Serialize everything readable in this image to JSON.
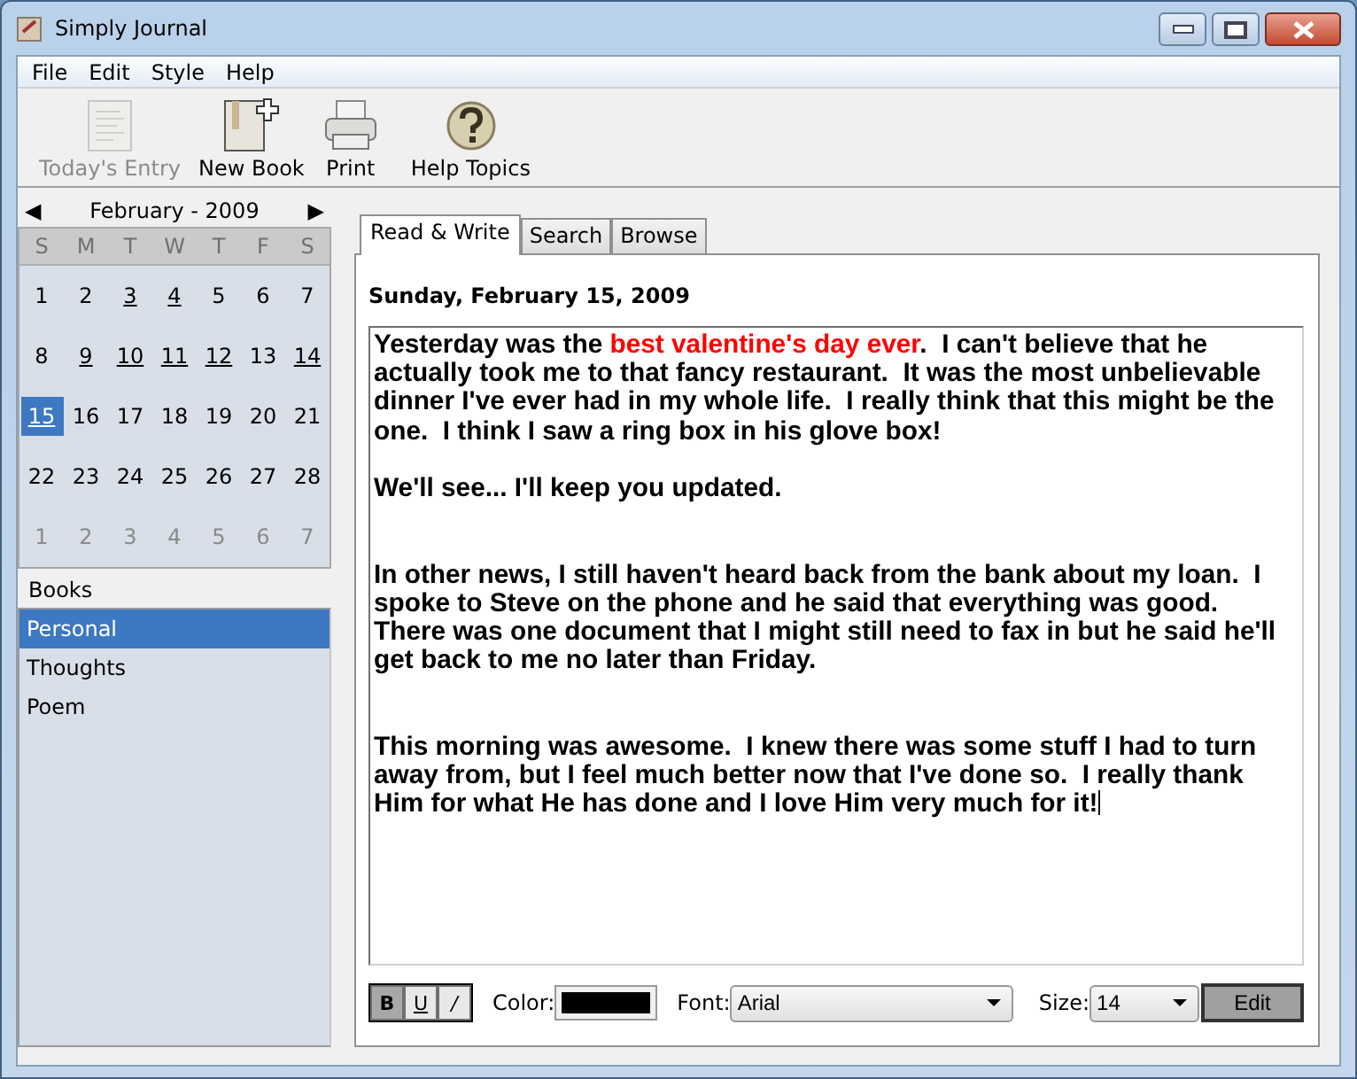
{
  "window": {
    "title": "Simply Journal"
  },
  "menu": [
    {
      "label": "File"
    },
    {
      "label": "Edit"
    },
    {
      "label": "Style"
    },
    {
      "label": "Help"
    }
  ],
  "toolbar": [
    {
      "label": "Today's Entry",
      "kind": "page",
      "disabled": true
    },
    {
      "label": "New Book",
      "kind": "book",
      "disabled": false
    },
    {
      "label": "Print",
      "kind": "printer",
      "disabled": false
    },
    {
      "label": "Help Topics",
      "kind": "help",
      "disabled": false
    }
  ],
  "calendar": {
    "prev": "◀",
    "month": "February - 2009",
    "next": "▶",
    "weekdays": [
      "S",
      "M",
      "T",
      "W",
      "T",
      "F",
      "S"
    ],
    "days": [
      {
        "label": "1",
        "kind": "current",
        "has_entry": false,
        "selected": false
      },
      {
        "label": "2",
        "kind": "current",
        "has_entry": false,
        "selected": false
      },
      {
        "label": "3",
        "kind": "current",
        "has_entry": true,
        "selected": false
      },
      {
        "label": "4",
        "kind": "current",
        "has_entry": true,
        "selected": false
      },
      {
        "label": "5",
        "kind": "current",
        "has_entry": false,
        "selected": false
      },
      {
        "label": "6",
        "kind": "current",
        "has_entry": false,
        "selected": false
      },
      {
        "label": "7",
        "kind": "current",
        "has_entry": false,
        "selected": false
      },
      {
        "label": "8",
        "kind": "current",
        "has_entry": false,
        "selected": false
      },
      {
        "label": "9",
        "kind": "current",
        "has_entry": true,
        "selected": false
      },
      {
        "label": "10",
        "kind": "current",
        "has_entry": true,
        "selected": false
      },
      {
        "label": "11",
        "kind": "current",
        "has_entry": true,
        "selected": false
      },
      {
        "label": "12",
        "kind": "current",
        "has_entry": true,
        "selected": false
      },
      {
        "label": "13",
        "kind": "current",
        "has_entry": false,
        "selected": false
      },
      {
        "label": "14",
        "kind": "current",
        "has_entry": true,
        "selected": false
      },
      {
        "label": "15",
        "kind": "current",
        "has_entry": true,
        "selected": true
      },
      {
        "label": "16",
        "kind": "current",
        "has_entry": false,
        "selected": false
      },
      {
        "label": "17",
        "kind": "current",
        "has_entry": false,
        "selected": false
      },
      {
        "label": "18",
        "kind": "current",
        "has_entry": false,
        "selected": false
      },
      {
        "label": "19",
        "kind": "current",
        "has_entry": false,
        "selected": false
      },
      {
        "label": "20",
        "kind": "current",
        "has_entry": false,
        "selected": false
      },
      {
        "label": "21",
        "kind": "current",
        "has_entry": false,
        "selected": false
      },
      {
        "label": "22",
        "kind": "current",
        "has_entry": false,
        "selected": false
      },
      {
        "label": "23",
        "kind": "current",
        "has_entry": false,
        "selected": false
      },
      {
        "label": "24",
        "kind": "current",
        "has_entry": false,
        "selected": false
      },
      {
        "label": "25",
        "kind": "current",
        "has_entry": false,
        "selected": false
      },
      {
        "label": "26",
        "kind": "current",
        "has_entry": false,
        "selected": false
      },
      {
        "label": "27",
        "kind": "current",
        "has_entry": false,
        "selected": false
      },
      {
        "label": "28",
        "kind": "current",
        "has_entry": false,
        "selected": false
      },
      {
        "label": "1",
        "kind": "other",
        "has_entry": false,
        "selected": false
      },
      {
        "label": "2",
        "kind": "other",
        "has_entry": false,
        "selected": false
      },
      {
        "label": "3",
        "kind": "other",
        "has_entry": false,
        "selected": false
      },
      {
        "label": "4",
        "kind": "other",
        "has_entry": false,
        "selected": false
      },
      {
        "label": "5",
        "kind": "other",
        "has_entry": false,
        "selected": false
      },
      {
        "label": "6",
        "kind": "other",
        "has_entry": false,
        "selected": false
      },
      {
        "label": "7",
        "kind": "other",
        "has_entry": false,
        "selected": false
      }
    ]
  },
  "books": {
    "title": "Books",
    "items": [
      {
        "label": "Personal",
        "selected": true
      },
      {
        "label": "Thoughts",
        "selected": false
      },
      {
        "label": "Poem",
        "selected": false
      }
    ]
  },
  "tabs": [
    {
      "label": "Read & Write",
      "selected": true
    },
    {
      "label": "Search",
      "selected": false
    },
    {
      "label": "Browse",
      "selected": false
    }
  ],
  "entry": {
    "date": "Sunday, February 15, 2009",
    "runs": [
      {
        "text": "Yesterday was the ",
        "color": "#000000"
      },
      {
        "text": "best valentine's day ever",
        "color": "#ff0000"
      },
      {
        "text": ".  I can't believe that he actually took me to that fancy restaurant.  It was the most unbelievable dinner I've ever had in my whole life.  I really think that this might be the one.  I think I saw a ring box in his glove box!\n\nWe'll see... I'll keep you updated.\n\n\nIn other news, I still haven't heard back from the bank about my loan.  I spoke to Steve on the phone and he said that everything was good.  There was one document that I might still need to fax in but he said he'll get back to me no later than Friday.\n\n\nThis morning was awesome.  I knew there was some stuff I had to turn away from, but I feel much better now that I've done so.  I really thank Him for what He has done and I love Him very much for it!",
        "color": "#000000"
      }
    ]
  },
  "format": {
    "styles": [
      {
        "label": "B",
        "kind": "bold",
        "on": true
      },
      {
        "label": "U",
        "kind": "underline",
        "on": false
      },
      {
        "label": "/",
        "kind": "italic",
        "on": false
      }
    ],
    "color_label": "Color:",
    "color": "#000000",
    "font_label": "Font:",
    "font": "Arial",
    "size_label": "Size:",
    "size": "14",
    "edit": "Edit"
  }
}
